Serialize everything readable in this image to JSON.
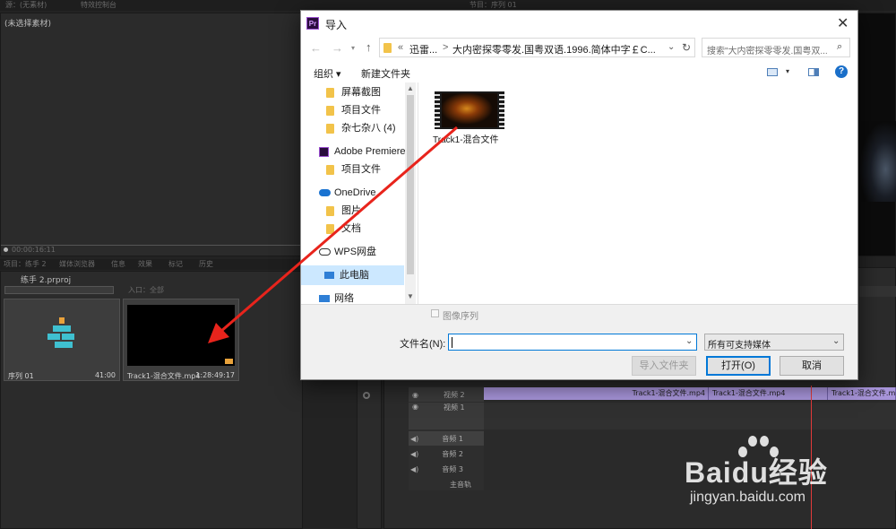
{
  "premiere": {
    "top_tabs": [
      "源：(无素材)",
      "特效控制台",
      "节目：序列 01"
    ],
    "source_monitor_label": "(未选择素材)",
    "source_timecode": "00:00:16:11",
    "project_tabs": [
      "项目：练手 2",
      "媒体浏览器",
      "信息",
      "效果",
      "标记",
      "历史"
    ],
    "project_name": "练手 2.prproj",
    "search_placeholder": "",
    "entry_label": "入口：全部",
    "bins": [
      {
        "name": "序列 01",
        "duration": "41:00"
      },
      {
        "name": "Track1-混合文件.mp4",
        "duration": "1:28:49:17"
      }
    ],
    "tracks": [
      {
        "label": "视频 2"
      },
      {
        "label": "视频 1"
      },
      {
        "label": "音频 1"
      },
      {
        "label": "音频 2"
      },
      {
        "label": "音频 3"
      },
      {
        "label": "主音轨"
      }
    ],
    "clips": [
      "Track1-混合文件.mp4",
      "Track1-混合文件.mp4",
      "Track1-混合文件.mp4"
    ]
  },
  "dialog": {
    "title": "导入",
    "app_icon": "Pr",
    "path_prefix": "«",
    "path_seg1": "迅雷...",
    "path_sep": ">",
    "path_seg2": "大内密探零零发.国粤双语.1996.简体中字￡C...",
    "search_placeholder": "搜索\"大内密探零零发.国粤双...",
    "organize_label": "组织 ▾",
    "new_folder_label": "新建文件夹",
    "help_label": "?",
    "nav_items": [
      {
        "label": "屏幕截图",
        "icon": "folder-icon"
      },
      {
        "label": "项目文件",
        "icon": "folder-icon"
      },
      {
        "label": "杂七杂八 (4)",
        "icon": "folder-icon"
      },
      {
        "label": "Adobe Premiere",
        "icon": "premiere-icon"
      },
      {
        "label": "项目文件",
        "icon": "folder-icon"
      },
      {
        "label": "OneDrive",
        "icon": "cloud-icon"
      },
      {
        "label": "图片",
        "icon": "folder-icon"
      },
      {
        "label": "文档",
        "icon": "folder-icon"
      },
      {
        "label": "WPS网盘",
        "icon": "cloud-icon"
      },
      {
        "label": "此电脑",
        "icon": "computer-icon"
      },
      {
        "label": "网络",
        "icon": "network-icon"
      }
    ],
    "file_item": "Track1-混合文件",
    "image_sequence_label": "图像序列",
    "filename_label": "文件名(N):",
    "filename_value": "",
    "filetype_value": "所有可支持媒体",
    "import_folder_button": "导入文件夹",
    "open_button": "打开(O)",
    "cancel_button": "取消"
  },
  "watermark": {
    "brand": "Baidu经验",
    "url": "jingyan.baidu.com"
  },
  "colors": {
    "clip_purple": "#a794d9",
    "arrow_red": "#e8241c",
    "accent_blue": "#0078d7"
  }
}
